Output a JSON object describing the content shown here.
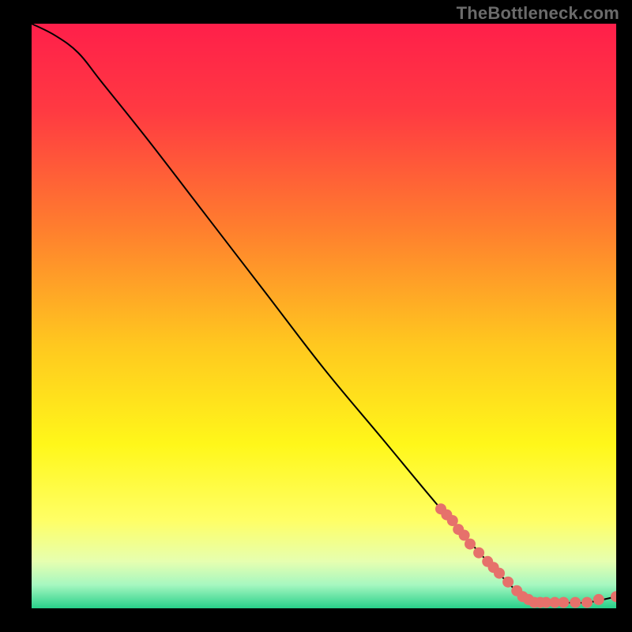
{
  "watermark": "TheBottleneck.com",
  "chart_data": {
    "type": "line",
    "title": "",
    "xlabel": "",
    "ylabel": "",
    "xlim": [
      0,
      100
    ],
    "ylim": [
      0,
      100
    ],
    "grid": false,
    "legend": false,
    "series": [
      {
        "name": "curve",
        "color": "#000000",
        "style": "line",
        "points": [
          {
            "x": 0,
            "y": 100
          },
          {
            "x": 4,
            "y": 98
          },
          {
            "x": 8,
            "y": 95
          },
          {
            "x": 12,
            "y": 90
          },
          {
            "x": 20,
            "y": 80
          },
          {
            "x": 30,
            "y": 67
          },
          {
            "x": 40,
            "y": 54
          },
          {
            "x": 50,
            "y": 41
          },
          {
            "x": 60,
            "y": 29
          },
          {
            "x": 70,
            "y": 17
          },
          {
            "x": 78,
            "y": 8
          },
          {
            "x": 84,
            "y": 2
          },
          {
            "x": 86,
            "y": 1
          },
          {
            "x": 90,
            "y": 1
          },
          {
            "x": 95,
            "y": 1
          },
          {
            "x": 100,
            "y": 2
          }
        ]
      },
      {
        "name": "highlight-points",
        "color": "#e6716b",
        "style": "marker",
        "points": [
          {
            "x": 70,
            "y": 17
          },
          {
            "x": 71,
            "y": 16
          },
          {
            "x": 72,
            "y": 15
          },
          {
            "x": 73,
            "y": 13.5
          },
          {
            "x": 74,
            "y": 12.5
          },
          {
            "x": 75,
            "y": 11
          },
          {
            "x": 76.5,
            "y": 9.5
          },
          {
            "x": 78,
            "y": 8
          },
          {
            "x": 79,
            "y": 7
          },
          {
            "x": 80,
            "y": 6
          },
          {
            "x": 81.5,
            "y": 4.5
          },
          {
            "x": 83,
            "y": 3
          },
          {
            "x": 84,
            "y": 2
          },
          {
            "x": 85,
            "y": 1.5
          },
          {
            "x": 86,
            "y": 1
          },
          {
            "x": 87,
            "y": 1
          },
          {
            "x": 88,
            "y": 1
          },
          {
            "x": 89.5,
            "y": 1
          },
          {
            "x": 91,
            "y": 1
          },
          {
            "x": 93,
            "y": 1
          },
          {
            "x": 95,
            "y": 1
          },
          {
            "x": 97,
            "y": 1.5
          },
          {
            "x": 100,
            "y": 2
          }
        ]
      }
    ],
    "background_gradient": {
      "type": "vertical",
      "stops": [
        {
          "pos": 0.0,
          "color": "#ff1f4a"
        },
        {
          "pos": 0.15,
          "color": "#ff3a42"
        },
        {
          "pos": 0.35,
          "color": "#ff7e2e"
        },
        {
          "pos": 0.55,
          "color": "#ffc81f"
        },
        {
          "pos": 0.72,
          "color": "#fff71a"
        },
        {
          "pos": 0.85,
          "color": "#ffff66"
        },
        {
          "pos": 0.92,
          "color": "#e6ffb0"
        },
        {
          "pos": 0.96,
          "color": "#a6f7c0"
        },
        {
          "pos": 1.0,
          "color": "#28d08a"
        }
      ]
    }
  }
}
